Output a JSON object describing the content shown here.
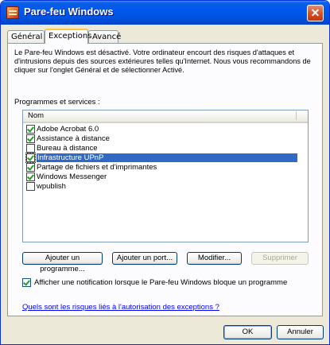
{
  "window": {
    "title": "Pare-feu Windows",
    "close_glyph": "✕"
  },
  "tabs": [
    {
      "label": "Général"
    },
    {
      "label": "Exceptions"
    },
    {
      "label": "Avancé"
    }
  ],
  "info_text": "Le Pare-feu Windows est désactivé. Votre ordinateur encourt des risques d'attaques et d'intrusions depuis des sources extérieures telles qu'Internet. Nous vous recommandons de cliquer sur l'onglet Général et de sélectionner Activé.",
  "programs_label": "Programmes et services :",
  "list": {
    "column_header": "Nom",
    "items": [
      {
        "label": "Adobe Acrobat 6.0",
        "checked": true
      },
      {
        "label": "Assistance à distance",
        "checked": true
      },
      {
        "label": "Bureau à distance",
        "checked": false
      },
      {
        "label": "Infrastructure UPnP",
        "checked": true,
        "selected": true
      },
      {
        "label": "Partage de fichiers et d'imprimantes",
        "checked": true
      },
      {
        "label": "Windows Messenger",
        "checked": true
      },
      {
        "label": "wpublish",
        "checked": false
      }
    ]
  },
  "buttons": {
    "add_program": "Ajouter un programme...",
    "add_port": "Ajouter un port...",
    "modify": "Modifier...",
    "delete": "Supprimer"
  },
  "notify_label": "Afficher une notification lorsque le Pare-feu Windows bloque un programme",
  "link_text": "Quels sont les risques liés à l'autorisation des exceptions ?",
  "footer": {
    "ok": "OK",
    "cancel": "Annuler"
  }
}
